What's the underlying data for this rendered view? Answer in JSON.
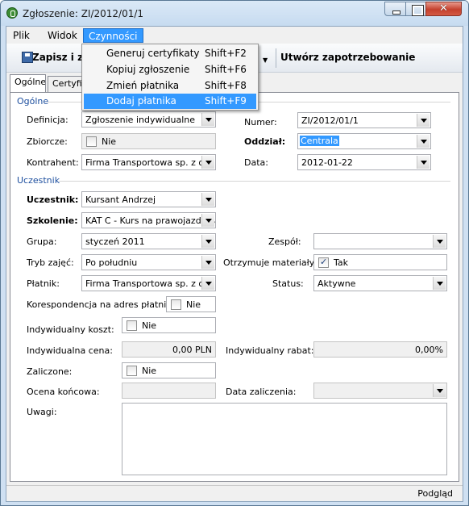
{
  "window": {
    "title": "Zgłoszenie: ZI/2012/01/1"
  },
  "menubar": {
    "items": [
      "Plik",
      "Widok",
      "Czynności"
    ]
  },
  "toolbar": {
    "save_label": "Zapisz i za",
    "create_label": "Utwórz zapotrzebowanie"
  },
  "menu_popup": {
    "items": [
      {
        "label": "Generuj certyfikaty",
        "shortcut": "Shift+F2"
      },
      {
        "label": "Kopiuj zgłoszenie",
        "shortcut": "Shift+F6"
      },
      {
        "label": "Zmień płatnika",
        "shortcut": "Shift+F8"
      },
      {
        "label": "Dodaj płatnika",
        "shortcut": "Shift+F9"
      }
    ]
  },
  "tabs": [
    "Ogólne",
    "Certyfikaty"
  ],
  "ogolne": {
    "section": "Ogólne",
    "definicja_label": "Definicja:",
    "definicja_value": "Zgłoszenie indywidualne",
    "numer_label": "Numer:",
    "numer_value": "ZI/2012/01/1",
    "zbiorcze_label": "Zbiorcze:",
    "zbiorcze_value": "Nie",
    "oddzial_label": "Oddział:",
    "oddzial_value": "Centrala",
    "kontrahent_label": "Kontrahent:",
    "kontrahent_value": "Firma Transportowa sp. z o.o.",
    "data_label": "Data:",
    "data_value": "2012-01-22"
  },
  "uczestnik": {
    "section": "Uczestnik",
    "uczestnik_label": "Uczestnik:",
    "uczestnik_value": "Kursant Andrzej",
    "szkolenie_label": "Szkolenie:",
    "szkolenie_value": "KAT C - Kurs na prawojazdy kat. C",
    "grupa_label": "Grupa:",
    "grupa_value": "styczeń 2011",
    "zespol_label": "Zespół:",
    "zespol_value": "",
    "tryb_label": "Tryb zajęć:",
    "tryb_value": "Po południu",
    "materialy_label": "Otrzymuje materiały:",
    "materialy_value": "Tak",
    "platnik_label": "Płatnik:",
    "platnik_value": "Firma Transportowa sp. z o.o.",
    "status_label": "Status:",
    "status_value": "Aktywne",
    "koresp_label": "Korespondencja na adres płatnika:",
    "koresp_value": "Nie",
    "koszt_label": "Indywidualny koszt:",
    "koszt_value": "Nie",
    "cena_label": "Indywidualna cena:",
    "cena_value": "0,00 PLN",
    "rabat_label": "Indywidualny rabat:",
    "rabat_value": "0,00%",
    "zaliczone_label": "Zaliczone:",
    "zaliczone_value": "Nie",
    "ocena_label": "Ocena końcowa:",
    "ocena_value": "",
    "data_zal_label": "Data zaliczenia:",
    "data_zal_value": "",
    "uwagi_label": "Uwagi:",
    "uwagi_value": ""
  },
  "statusbar": {
    "text": "Podgląd"
  }
}
